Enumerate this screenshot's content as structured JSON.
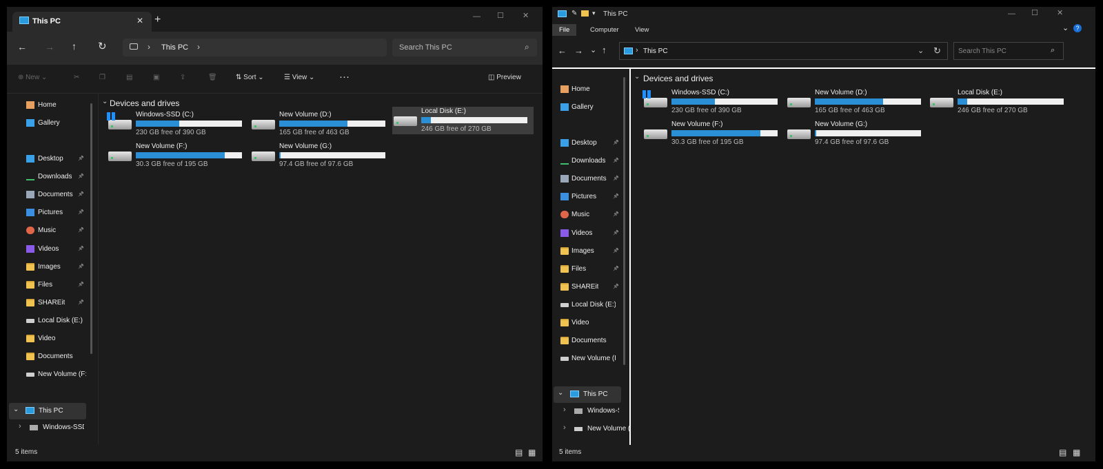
{
  "w1": {
    "tab_title": "This PC",
    "breadcrumb": "This PC",
    "search_placeholder": "Search This PC",
    "toolbar": {
      "new": "New",
      "sort": "Sort",
      "view": "View",
      "preview": "Preview"
    },
    "quick_nav": [
      {
        "label": "Home",
        "icon": "home-icon"
      },
      {
        "label": "Gallery",
        "icon": "gallery-icon"
      }
    ],
    "pinned": [
      {
        "label": "Desktop",
        "icon": "desktop-icon",
        "pinned": true
      },
      {
        "label": "Downloads",
        "icon": "downloads-icon",
        "pinned": true
      },
      {
        "label": "Documents",
        "icon": "documents-icon",
        "pinned": true
      },
      {
        "label": "Pictures",
        "icon": "pictures-icon",
        "pinned": true
      },
      {
        "label": "Music",
        "icon": "music-icon",
        "pinned": true
      },
      {
        "label": "Videos",
        "icon": "videos-icon",
        "pinned": true
      },
      {
        "label": "Images",
        "icon": "folder-icon",
        "pinned": true
      },
      {
        "label": "Files",
        "icon": "folder-icon",
        "pinned": true
      },
      {
        "label": "SHAREit",
        "icon": "folder-icon",
        "pinned": true
      },
      {
        "label": "Local Disk (E:)",
        "icon": "drive-icon",
        "pinned": false
      },
      {
        "label": "Video",
        "icon": "folder-icon",
        "pinned": false
      },
      {
        "label": "Documents",
        "icon": "folder-icon",
        "pinned": false
      },
      {
        "label": "New Volume (F:",
        "icon": "drive-icon",
        "pinned": false
      }
    ],
    "tree": {
      "this_pc": "This PC",
      "windows_ssd": "Windows-SSD"
    },
    "group_label": "Devices and drives",
    "status": "5 items"
  },
  "w2": {
    "title": "This PC",
    "ribbon_tabs": [
      "File",
      "Computer",
      "View"
    ],
    "breadcrumb": "This PC",
    "search_placeholder": "Search This PC",
    "quick_nav": [
      {
        "label": "Home",
        "icon": "home-icon"
      },
      {
        "label": "Gallery",
        "icon": "gallery-icon"
      }
    ],
    "pinned": [
      {
        "label": "Desktop",
        "icon": "desktop-icon",
        "pinned": true
      },
      {
        "label": "Downloads",
        "icon": "downloads-icon",
        "pinned": true
      },
      {
        "label": "Documents",
        "icon": "documents-icon",
        "pinned": true
      },
      {
        "label": "Pictures",
        "icon": "pictures-icon",
        "pinned": true
      },
      {
        "label": "Music",
        "icon": "music-icon",
        "pinned": true
      },
      {
        "label": "Videos",
        "icon": "videos-icon",
        "pinned": true
      },
      {
        "label": "Images",
        "icon": "folder-icon",
        "pinned": true
      },
      {
        "label": "Files",
        "icon": "folder-icon",
        "pinned": true
      },
      {
        "label": "SHAREit",
        "icon": "folder-icon",
        "pinned": true
      },
      {
        "label": "Local Disk (E:)",
        "icon": "drive-icon",
        "pinned": false
      },
      {
        "label": "Video",
        "icon": "folder-icon",
        "pinned": false
      },
      {
        "label": "Documents",
        "icon": "folder-icon",
        "pinned": false
      },
      {
        "label": "New Volume (F:",
        "icon": "drive-icon",
        "pinned": false
      }
    ],
    "tree": {
      "this_pc": "This PC",
      "windows_ssd": "Windows-SSD",
      "new_volume": "New Volume ("
    },
    "group_label": "Devices and drives",
    "status": "5 items"
  },
  "drives": [
    {
      "name": "Windows-SSD (C:)",
      "free": "230 GB free of 390 GB",
      "used_fraction": 0.41,
      "windows": true
    },
    {
      "name": "New Volume (D:)",
      "free": "165 GB free of 463 GB",
      "used_fraction": 0.64,
      "windows": false
    },
    {
      "name": "Local Disk (E:)",
      "free": "246 GB free of 270 GB",
      "used_fraction": 0.09,
      "windows": false
    },
    {
      "name": "New Volume (F:)",
      "free": "30.3 GB free of 195 GB",
      "used_fraction": 0.84,
      "windows": false
    },
    {
      "name": "New Volume (G:)",
      "free": "97.4 GB free of 97.6 GB",
      "used_fraction": 0.01,
      "windows": false
    }
  ],
  "colors": {
    "accent": "#2b8fd6",
    "selected": "#3d3d3d",
    "folder": "#f0c350"
  }
}
